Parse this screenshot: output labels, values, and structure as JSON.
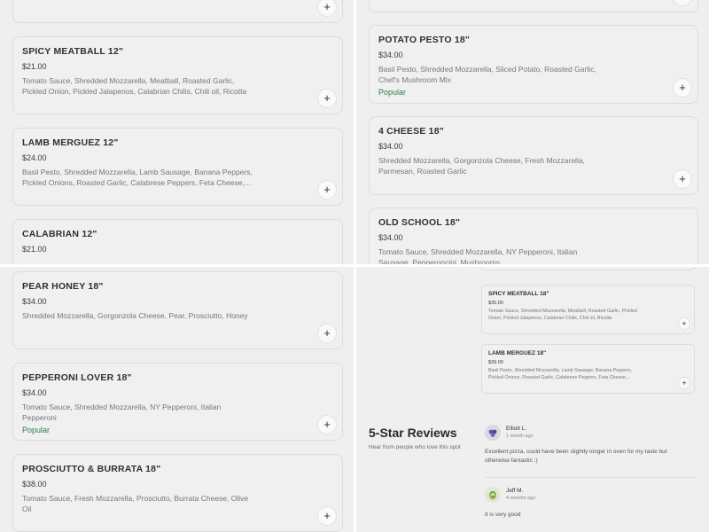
{
  "quad_tl": {
    "items": [
      {
        "name": "SPICY MEATBALL 12\"",
        "price": "$21.00",
        "desc": "Tomato Sauce, Shredded Mozzarella, Meatball, Roasted Garlic, Pickled Onion, Pickled Jalapenos, Calabrian Chilis, Chili oil, Ricotta"
      },
      {
        "name": "LAMB MERGUEZ 12\"",
        "price": "$24.00",
        "desc": "Basil Pesto, Shredded Mozzarella, Lamb Sausage, Banana Peppers, Pickled Onions, Roasted Garlic, Calabrese Peppers, Feta Cheese,..."
      },
      {
        "name": "CALABRIAN 12\"",
        "price": "$21.00",
        "desc": ""
      }
    ]
  },
  "quad_tr": {
    "items": [
      {
        "name": "POTATO PESTO 18\"",
        "price": "$34.00",
        "desc": "Basil Pesto, Shredded Mozzarella, Sliced Potato, Roasted Garlic, Chef's Mushroom Mix",
        "badge": "Popular"
      },
      {
        "name": "4 CHEESE 18\"",
        "price": "$34.00",
        "desc": "Shredded Mozzarella, Gorgonzola Cheese, Fresh Mozzarella, Parmesan, Roasted Garlic"
      },
      {
        "name": "OLD SCHOOL 18\"",
        "price": "$34.00",
        "desc": "Tomato Sauce, Shredded Mozzarella, NY Pepperoni, Italian Sausage, Pepperoncini, Mushrooms"
      }
    ]
  },
  "quad_bl": {
    "items": [
      {
        "name": "PEAR HONEY 18\"",
        "price": "$34.00",
        "desc": "Shredded Mozzarella, Gorgonzola Cheese, Pear, Prosciutto, Honey"
      },
      {
        "name": "PEPPERONI LOVER 18\"",
        "price": "$34.00",
        "desc": "Tomato Sauce, Shredded Mozzarella, NY Pepperoni, Italian Pepperoni",
        "badge": "Popular"
      },
      {
        "name": "PROSCIUTTO & BURRATA 18\"",
        "price": "$38.00",
        "desc": "Tomato Sauce, Fresh Mozzarella, Prosciutto, Burrata Cheese, Olive Oil"
      }
    ]
  },
  "quad_br": {
    "items": [
      {
        "name": "SPICY MEATBALL 18\"",
        "price": "$35.00",
        "desc": "Tomato Sauce, Shredded Mozzarella, Meatball, Roasted Garlic, Pickled Onion, Pickled Jalapenos, Calabrian Chilis, Chili oil, Ricotta"
      },
      {
        "name": "LAMB MERGUEZ 18\"",
        "price": "$39.00",
        "desc": "Basil Pesto, Shredded Mozzarella, Lamb Sausage, Banana Peppers, Pickled Onions, Roasted Garlic, Calabrese Peppers, Feta Cheese,..."
      }
    ],
    "reviews_title": "5-Star Reviews",
    "reviews_subtitle": "Hear from people who love this spot",
    "reviews": [
      {
        "author": "Elliott L.",
        "time": "1 month ago",
        "text": "Excellent pizza, could have been slightly longer in oven for my taste but otherwise fantastic :)",
        "avatar_icon": "berries-avatar-icon",
        "avatar_color": "#5b5aa8"
      },
      {
        "author": "Jeff M.",
        "time": "4 months ago",
        "text": "It is very good",
        "avatar_icon": "avocado-avatar-icon",
        "avatar_color": "#6ea04a"
      }
    ]
  },
  "add_label": "+"
}
